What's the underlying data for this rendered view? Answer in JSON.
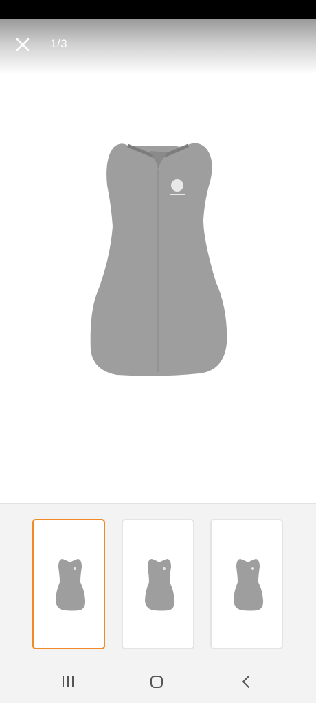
{
  "header": {
    "counter": "1/3",
    "close_icon": "close-icon"
  },
  "colors": {
    "selected_border": "#f08a24",
    "garment": "#9e9e9e",
    "thumb_border": "#e4e4e4"
  },
  "gallery": {
    "current_index": 1,
    "total": 3,
    "thumbnails": [
      {
        "selected": true
      },
      {
        "selected": false
      },
      {
        "selected": false
      }
    ]
  },
  "nav": {
    "recents_icon": "recents-icon",
    "home_icon": "home-icon",
    "back_icon": "back-icon"
  }
}
